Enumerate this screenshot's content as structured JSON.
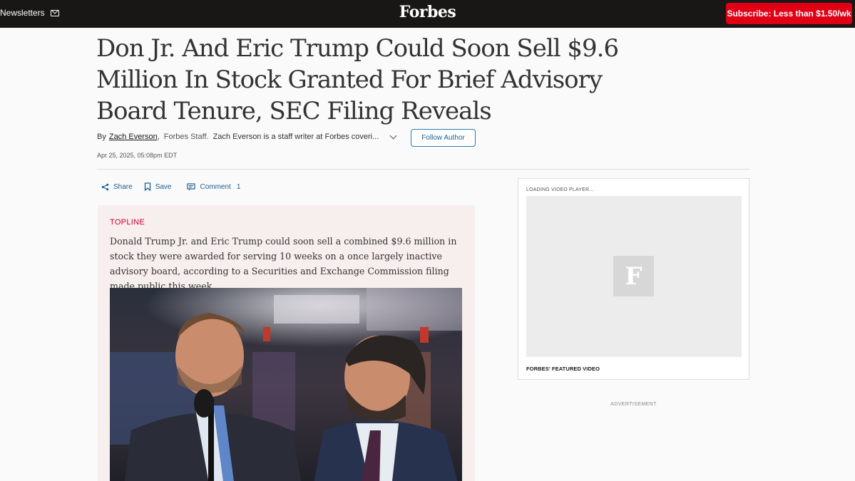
{
  "topbar": {
    "newsletters_label": "Newsletters",
    "logo": "Forbes",
    "subscribe_label": "Subscribe: Less than $1.50/wk"
  },
  "article": {
    "headline": "Don Jr. And Eric Trump Could Soon Sell $9.6 Million In Stock Granted For Brief Advisory Board Tenure, SEC Filing Reveals",
    "by_label": "By",
    "author": "Zach Everson",
    "author_role": "Forbes Staff.",
    "author_desc": "Zach Everson is a staff writer at Forbes coveri...",
    "follow_label": "Follow Author",
    "date": "Apr 25, 2025, 05:08pm EDT"
  },
  "actions": {
    "share_label": "Share",
    "save_label": "Save",
    "comment_label": "Comment",
    "comment_count": "1"
  },
  "topline": {
    "label": "TOPLINE",
    "text": "Donald Trump Jr. and Eric Trump could soon sell a combined $9.6 million in stock they were awarded for serving 10 weeks on a once largely inactive advisory board, according to a Securities and Exchange Commission filing made public this week."
  },
  "video": {
    "loading_label": "LOADING VIDEO PLAYER...",
    "placeholder_letter": "F",
    "featured_label": "FORBES' FEATURED VIDEO"
  },
  "advertisement_label": "ADVERTISEMENT",
  "colors": {
    "topbar": "#181716",
    "subscribe": "#e00015",
    "link_blue": "#1a5e96",
    "topline_bg": "#f7efed",
    "topline_label": "#cc0033"
  }
}
